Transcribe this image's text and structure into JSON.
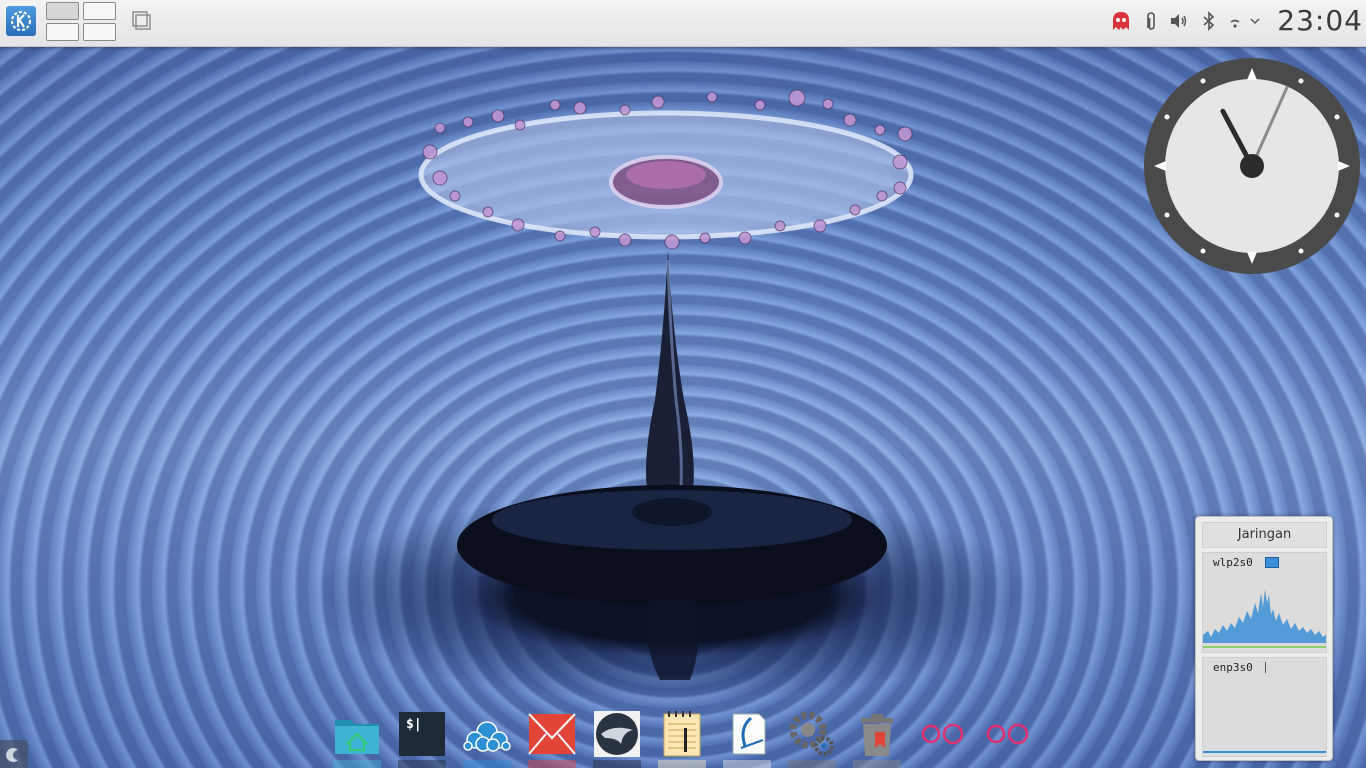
{
  "top_panel": {
    "launcher_icon": "kde-launcher-icon",
    "pager": {
      "desktops": 4,
      "active_desktop": 1
    },
    "show_desktop_icon": "show-desktop-icon",
    "tray": {
      "icons": [
        "ghost-app-icon",
        "paperclip-icon",
        "volume-icon",
        "bluetooth-icon",
        "wifi-icon",
        "expand-tray-icon"
      ],
      "clock": "23:04"
    }
  },
  "analog_clock": {
    "hour": 23,
    "minute": 4
  },
  "network_widget": {
    "title": "Jaringan",
    "interfaces": [
      {
        "name": "wlp2s0"
      },
      {
        "name": "enp3s0"
      }
    ]
  },
  "dock": {
    "items": [
      "file-manager-icon",
      "terminal-icon",
      "cloud-sync-icon",
      "mail-icon",
      "dolphin-logo-icon",
      "notes-icon",
      "office-writer-icon",
      "settings-gear-icon",
      "trash-icon",
      "flickr-dots-icon",
      "flickr-dots-icon"
    ],
    "terminal_label": "$|"
  },
  "colors": {
    "panel": "#e8e8e8",
    "kde_blue": "#2a6fb8",
    "ghost_red": "#d9333a",
    "net_graph": "#3b8fd6",
    "dock_pink": "#e0306f"
  }
}
